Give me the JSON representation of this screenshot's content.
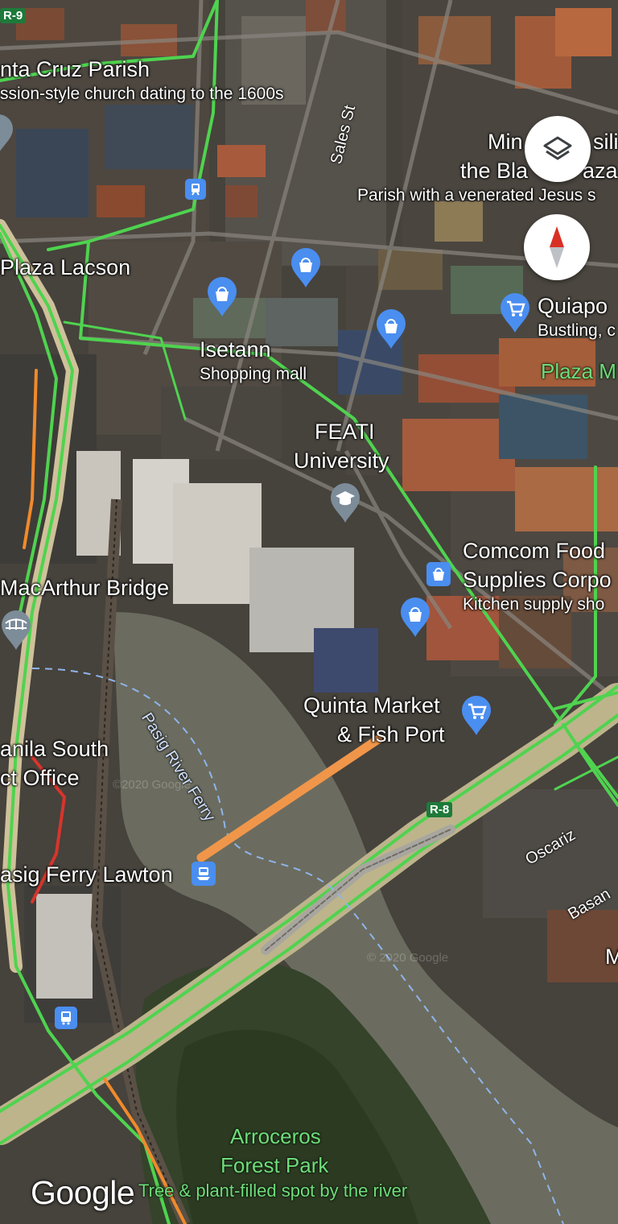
{
  "places": {
    "santa_cruz_title": "nta Cruz Parish",
    "santa_cruz_sub": "ssion-style church dating to the 1600s",
    "minor_title_1": "Min",
    "minor_title_1b": "silic",
    "minor_title_2": "the Bla",
    "minor_title_2b": "aza",
    "minor_sub": "Parish with a venerated Jesus s",
    "plaza_lacson": "Plaza Lacson",
    "quiapo_title": "Quiapo",
    "quiapo_sub": "Bustling, c",
    "plaza_m": "Plaza M",
    "isetann_title": "Isetann",
    "isetann_sub": "Shopping mall",
    "feati_1": "FEATI",
    "feati_2": "University",
    "comcom_1": "Comcom Food",
    "comcom_2": "Supplies Corpo",
    "comcom_sub": "Kitchen supply sho",
    "macarthur": "MacArthur Bridge",
    "quinta_1": "Quinta Market",
    "quinta_2": "& Fish Port",
    "manila_1": "anila South",
    "manila_2": "ct Office",
    "pasig_ferry_lawton": "asig Ferry Lawton",
    "arroceros_1": "Arroceros",
    "arroceros_2": "Forest Park",
    "arroceros_sub": "Tree & plant-filled spot by the river"
  },
  "roads": {
    "sales_st": "Sales St",
    "pasig_ferry_route": "Pasig River Ferry",
    "oscariz": "Oscariz",
    "basan": "Basan",
    "r9": "R-9",
    "r8": "R-8",
    "m_partial": "M"
  },
  "watermarks": [
    "©2020 Google",
    "© 2020 Google"
  ],
  "logo": "Google",
  "controls": {
    "layers_icon": "layers-icon",
    "compass_icon": "compass-icon"
  },
  "icons": {
    "shopping_bag": "shopping-bag-icon",
    "shopping_cart": "shopping-cart-icon",
    "education": "graduation-cap-icon",
    "bridge": "bridge-icon",
    "train": "train-station-icon",
    "bus": "bus-icon",
    "ferry": "ferry-icon"
  },
  "colors": {
    "traffic_green": "#4fd34f",
    "traffic_orange": "#f08a2c",
    "traffic_red": "#d6352c",
    "route_orange": "#f0964a",
    "poi_blue": "#4a8ef0",
    "education_gray": "#7d8c99",
    "compass_red": "#d93025"
  }
}
